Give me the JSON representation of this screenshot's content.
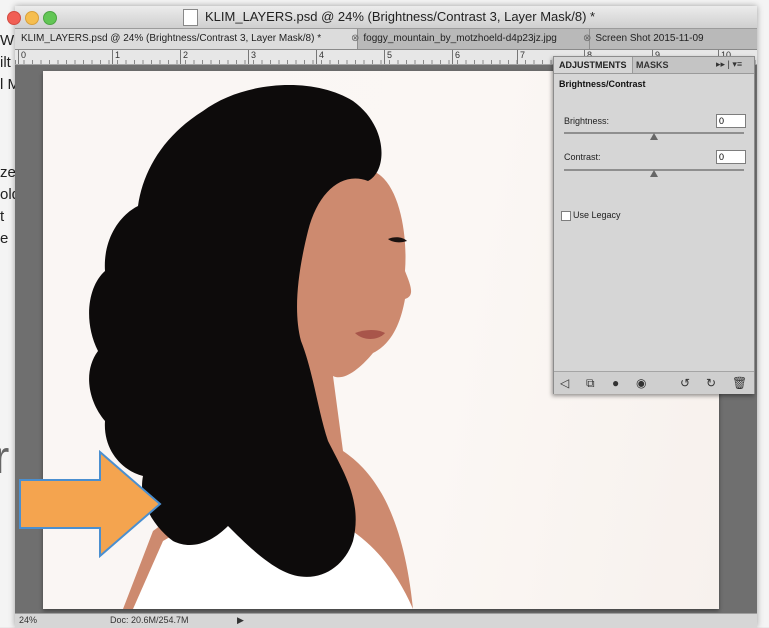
{
  "window": {
    "title": "KLIM_LAYERS.psd @ 24% (Brightness/Contrast 3, Layer Mask/8) *"
  },
  "background": {
    "text_lines": [
      "W",
      "ilt",
      "l M",
      "",
      "",
      "",
      "ze.",
      "old",
      "t",
      "e"
    ],
    "big_text": "r"
  },
  "tabs": [
    {
      "label": "KLIM_LAYERS.psd @ 24% (Brightness/Contrast 3, Layer Mask/8) *",
      "active": true
    },
    {
      "label": "foggy_mountain_by_motzhoeld-d4p23jz.jpg"
    },
    {
      "label": "Screen Shot 2015-11-09"
    }
  ],
  "ruler": {
    "numbers": [
      "0",
      "1",
      "2",
      "3",
      "4",
      "5",
      "6",
      "7",
      "8",
      "9",
      "10"
    ]
  },
  "adjustments": {
    "tab_adjustments": "ADJUSTMENTS",
    "tab_masks": "MASKS",
    "menu": "▸▸ | ▾≡",
    "title": "Brightness/Contrast",
    "brightness_label": "Brightness:",
    "brightness_value": "0",
    "contrast_label": "Contrast:",
    "contrast_value": "0",
    "legacy_label": "Use Legacy"
  },
  "status": {
    "zoom": "24%",
    "doc": "Doc: 20.6M/254.7M",
    "arrow": "▶"
  },
  "colors": {
    "arrow_fill": "#f4a44f",
    "arrow_stroke": "#4a8fd0"
  }
}
